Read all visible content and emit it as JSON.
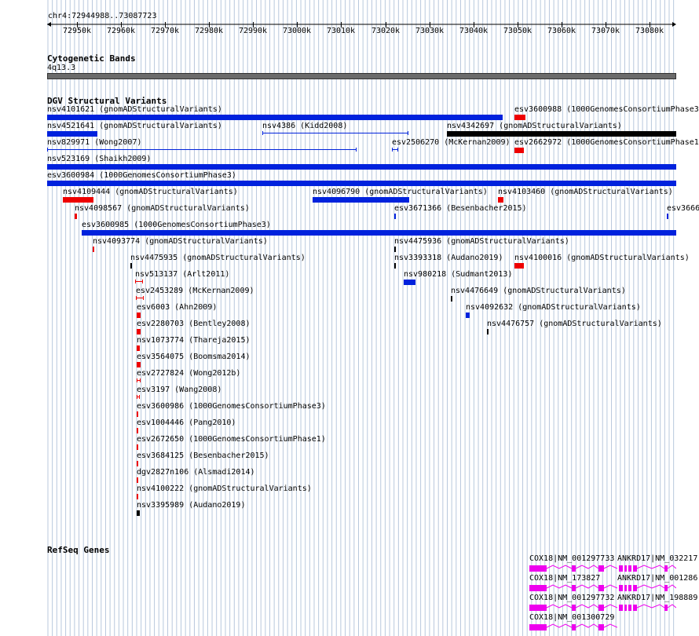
{
  "header": {
    "locus": "chr4:72944988..73087723"
  },
  "ruler": {
    "ticks": [
      "72950k",
      "72960k",
      "72970k",
      "72980k",
      "72990k",
      "73000k",
      "73010k",
      "73020k",
      "73030k",
      "73040k",
      "73050k",
      "73060k",
      "73070k",
      "73080k"
    ]
  },
  "tracks": {
    "cytogenetic_bands": {
      "title": "Cytogenetic Bands",
      "band": "4q13.3"
    },
    "dgv": {
      "title": "DGV Structural Variants"
    },
    "refseq": {
      "title": "RefSeq Genes"
    }
  },
  "colors": {
    "blue": "#0022dd",
    "red": "#ee0000",
    "black": "#000000",
    "magenta": "#ee00ee",
    "grid": "#b8c8dd",
    "band": "#6b6b6b"
  },
  "variants": [
    {
      "label": "nsv4101621 (gnomADStructuralVariants)",
      "color": "blue"
    },
    {
      "label": "esv3600988 (1000GenomesConsortiumPhase3)",
      "color": "red"
    },
    {
      "label": "nsv4521641 (gnomADStructuralVariants)",
      "color": "blue"
    },
    {
      "label": "nsv4386 (Kidd2008)",
      "color": "blue"
    },
    {
      "label": "nsv4342697 (gnomADStructuralVariants)",
      "color": "black"
    },
    {
      "label": "nsv829971 (Wong2007)",
      "color": "blue"
    },
    {
      "label": "esv2506270 (McKernan2009)",
      "color": "blue"
    },
    {
      "label": "esv2662972 (1000GenomesConsortiumPhase1)",
      "color": "red"
    },
    {
      "label": "nsv523169 (Shaikh2009)",
      "color": "blue"
    },
    {
      "label": "esv3600984 (1000GenomesConsortiumPhase3)",
      "color": "blue"
    },
    {
      "label": "nsv4109444 (gnomADStructuralVariants)",
      "color": "red"
    },
    {
      "label": "nsv4096790 (gnomADStructuralVariants)",
      "color": "blue"
    },
    {
      "label": "nsv4103460 (gnomADStructuralVariants)",
      "color": "red"
    },
    {
      "label": "nsv4098567 (gnomADStructuralVariants)",
      "color": "red"
    },
    {
      "label": "esv3671366 (Besenbacher2015)",
      "color": "blue"
    },
    {
      "label": "esv3666",
      "color": "blue"
    },
    {
      "label": "esv3600985 (1000GenomesConsortiumPhase3)",
      "color": "blue"
    },
    {
      "label": "nsv4093774 (gnomADStructuralVariants)",
      "color": "red"
    },
    {
      "label": "nsv4475936 (gnomADStructuralVariants)",
      "color": "black"
    },
    {
      "label": "nsv4475935 (gnomADStructuralVariants)",
      "color": "black"
    },
    {
      "label": "nsv3393318 (Audano2019)",
      "color": "black"
    },
    {
      "label": "nsv4100016 (gnomADStructuralVariants)",
      "color": "red"
    },
    {
      "label": "nsv513137 (Arlt2011)",
      "color": "red"
    },
    {
      "label": "nsv980218 (Sudmant2013)",
      "color": "blue"
    },
    {
      "label": "esv2453289 (McKernan2009)",
      "color": "red"
    },
    {
      "label": "nsv4476649 (gnomADStructuralVariants)",
      "color": "black"
    },
    {
      "label": "esv6003 (Ahn2009)",
      "color": "red"
    },
    {
      "label": "nsv4092632 (gnomADStructuralVariants)",
      "color": "blue"
    },
    {
      "label": "esv2280703 (Bentley2008)",
      "color": "red"
    },
    {
      "label": "nsv4476757 (gnomADStructuralVariants)",
      "color": "black"
    },
    {
      "label": "nsv1073774 (Thareja2015)",
      "color": "red"
    },
    {
      "label": "esv3564075 (Boomsma2014)",
      "color": "red"
    },
    {
      "label": "esv2727824 (Wong2012b)",
      "color": "red"
    },
    {
      "label": "esv3197 (Wang2008)",
      "color": "red"
    },
    {
      "label": "esv3600986 (1000GenomesConsortiumPhase3)",
      "color": "red"
    },
    {
      "label": "esv1004446 (Pang2010)",
      "color": "red"
    },
    {
      "label": "esv2672650 (1000GenomesConsortiumPhase1)",
      "color": "red"
    },
    {
      "label": "esv3684125 (Besenbacher2015)",
      "color": "red"
    },
    {
      "label": "dgv2827n106 (Alsmadi2014)",
      "color": "red"
    },
    {
      "label": "nsv4100222 (gnomADStructuralVariants)",
      "color": "red"
    },
    {
      "label": "nsv3395989 (Audano2019)",
      "color": "black"
    }
  ],
  "genes": [
    {
      "label": "COX18|NM_001297733"
    },
    {
      "label": "ANKRD17|NM_032217"
    },
    {
      "label": "COX18|NM_173827"
    },
    {
      "label": "ANKRD17|NM_001286"
    },
    {
      "label": "COX18|NM_001297732"
    },
    {
      "label": "ANKRD17|NM_198889"
    },
    {
      "label": "COX18|NM_001300729"
    }
  ]
}
